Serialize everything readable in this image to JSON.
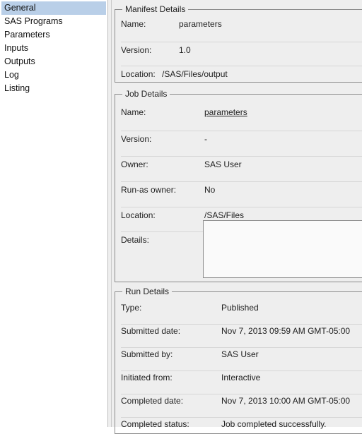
{
  "nav": {
    "items": [
      {
        "label": "General",
        "selected": true
      },
      {
        "label": "SAS Programs",
        "selected": false
      },
      {
        "label": "Parameters",
        "selected": false
      },
      {
        "label": "Inputs",
        "selected": false
      },
      {
        "label": "Outputs",
        "selected": false
      },
      {
        "label": "Log",
        "selected": false
      },
      {
        "label": "Listing",
        "selected": false
      }
    ]
  },
  "manifest": {
    "title": "Manifest Details",
    "name_label": "Name:",
    "name_value": "parameters",
    "version_label": "Version:",
    "version_value": "1.0",
    "location_label": "Location:",
    "location_value": "/SAS/Files/output"
  },
  "job": {
    "title": "Job Details",
    "name_label": "Name:",
    "name_value": "parameters",
    "version_label": "Version:",
    "version_value": "-",
    "owner_label": "Owner:",
    "owner_value": "SAS User",
    "runas_label": "Run-as owner:",
    "runas_value": "No",
    "location_label": "Location:",
    "location_value": "/SAS/Files",
    "details_label": "Details:",
    "details_value": ""
  },
  "run": {
    "title": "Run Details",
    "type_label": "Type:",
    "type_value": "Published",
    "submitted_date_label": "Submitted date:",
    "submitted_date_value": "Nov 7, 2013 09:59 AM GMT-05:00",
    "submitted_by_label": "Submitted by:",
    "submitted_by_value": "SAS User",
    "initiated_label": "Initiated from:",
    "initiated_value": "Interactive",
    "completed_date_label": "Completed date:",
    "completed_date_value": "Nov 7, 2013 10:00 AM GMT-05:00",
    "completed_status_label": "Completed status:",
    "completed_status_value": "Job completed successfully."
  }
}
